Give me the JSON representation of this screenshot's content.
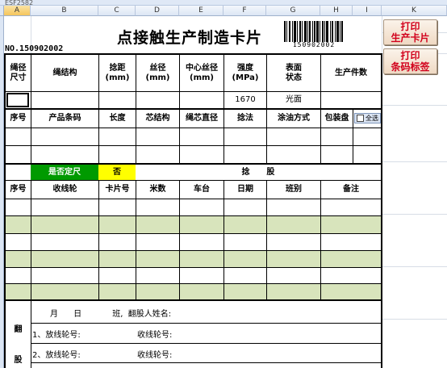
{
  "window": {
    "name_box": "_ESF2582"
  },
  "columns": [
    "A",
    "B",
    "C",
    "D",
    "E",
    "F",
    "G",
    "H",
    "I",
    "K"
  ],
  "selected_column": "A",
  "title": "点接触生产制造卡片",
  "card_no": "NO.150902002",
  "barcode_text": "150902002",
  "buttons": {
    "print_card": "打印\n生产卡片",
    "print_label": "打印\n条码标签"
  },
  "spec_headers": {
    "rope_diameter": "绳径\n尺寸",
    "rope_structure": "绳结构",
    "lay_length": "捻距\n(mm)",
    "wire_diameter": "丝径\n(mm)",
    "center_wire": "中心丝径\n(mm)",
    "strength": "强度\n(MPa)",
    "surface": "表面\n状态",
    "qty": "生产件数"
  },
  "spec_values": {
    "strength": "1670",
    "surface": "光面"
  },
  "product_headers": [
    "序号",
    "产品条码",
    "长度",
    "芯结构",
    "绳芯直径",
    "捻法",
    "涂油方式",
    "包装盘"
  ],
  "select_all": "全选",
  "fixed_length_label": "是否定尺",
  "fixed_length_value": "否",
  "twisting_label": "捻      股",
  "twist_headers": [
    "序号",
    "收线轮",
    "卡片号",
    "米数",
    "车台",
    "日期",
    "班别",
    "备注"
  ],
  "rewind": {
    "side_label_1": "翻",
    "side_label_2": "股",
    "line1": "月      日            班,  翻股人姓名:",
    "line2_left": "1、放线轮号:",
    "line2_right": "收线轮号:",
    "line3_left": "2、放线轮号:",
    "line3_right": "收线轮号:"
  }
}
